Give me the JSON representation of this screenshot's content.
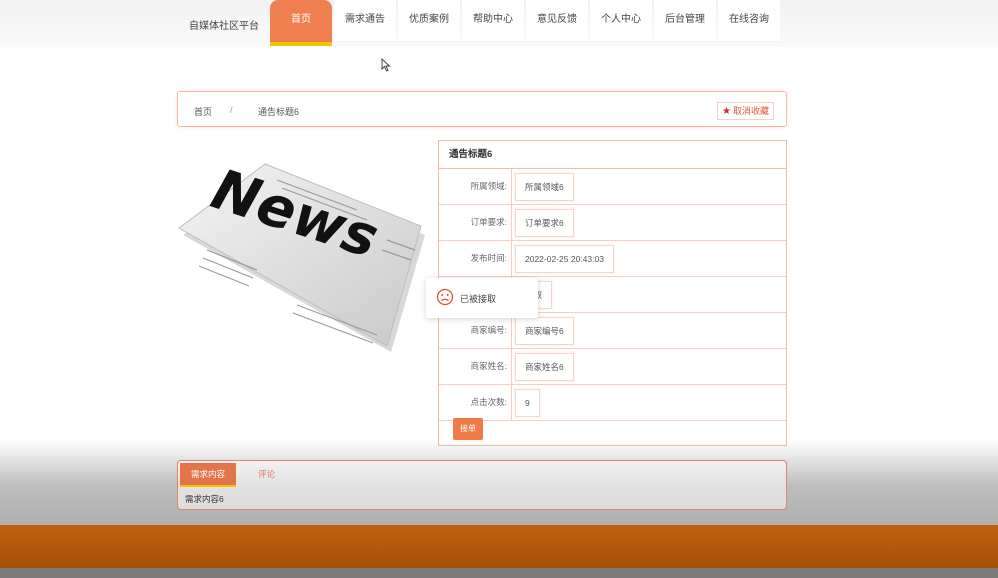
{
  "header": {
    "brand": "自媒体社区平台",
    "nav": [
      "首页",
      "需求通告",
      "优质案例",
      "帮助中心",
      "意见反馈",
      "个人中心",
      "后台管理",
      "在线咨询"
    ]
  },
  "breadcrumb": {
    "home": "首页",
    "sep": "/",
    "current": "通告标题6",
    "favorite": "取消收藏"
  },
  "news_image": {
    "word": "News"
  },
  "detail": {
    "title": "通告标题6",
    "rows": [
      {
        "label": "所属领域:",
        "value": "所属领域6"
      },
      {
        "label": "订单要求:",
        "value": "订单要求6"
      },
      {
        "label": "发布时间:",
        "value": "2022-02-25 20:43:03"
      },
      {
        "label": "",
        "value": "领取"
      },
      {
        "label": "商家编号:",
        "value": "商家编号6"
      },
      {
        "label": "商家姓名:",
        "value": "商家姓名6"
      },
      {
        "label": "点击次数:",
        "value": "9"
      }
    ],
    "button": "接单"
  },
  "toast": {
    "message": "已被接取"
  },
  "tabs": {
    "items": [
      "需求内容",
      "评论"
    ],
    "content": "需求内容6"
  },
  "colors": {
    "accent": "#f08050",
    "highlight": "#f5c400",
    "footer": "#b3560b"
  }
}
